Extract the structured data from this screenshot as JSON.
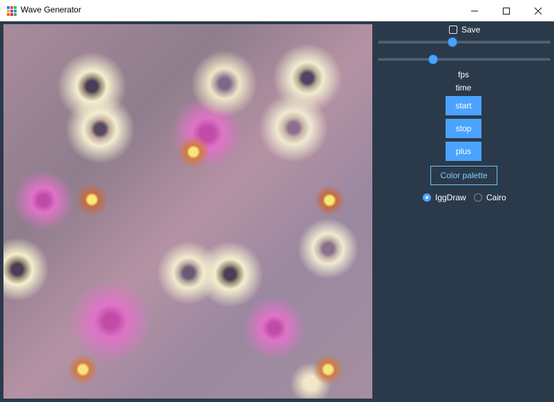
{
  "window": {
    "title": "Wave Generator",
    "controls": {
      "minimize_icon": "minimize-icon",
      "maximize_icon": "maximize-icon",
      "close_icon": "close-icon"
    }
  },
  "panel": {
    "save_label": "Save",
    "save_checked": false,
    "slider_1_value": 0.43,
    "slider_2_value": 0.31,
    "fps_label": "fps",
    "time_label": "time",
    "buttons": {
      "start": "start",
      "stop": "stop",
      "plus": "plus"
    },
    "palette_button": "Color palette",
    "renderer_options": [
      {
        "label": "IggDraw",
        "selected": true
      },
      {
        "label": "Cairo",
        "selected": false
      }
    ]
  },
  "colors": {
    "background": "#2b3a4a",
    "accent": "#4aa3ff",
    "outline_accent": "#6fc3ff"
  },
  "icons": {
    "app_icon": "app-icon",
    "checkbox_icon": "checkbox-icon",
    "slider_thumb": "slider-thumb-icon",
    "radio_selected": "radio-selected-icon",
    "radio_unselected": "radio-unselected-icon"
  }
}
